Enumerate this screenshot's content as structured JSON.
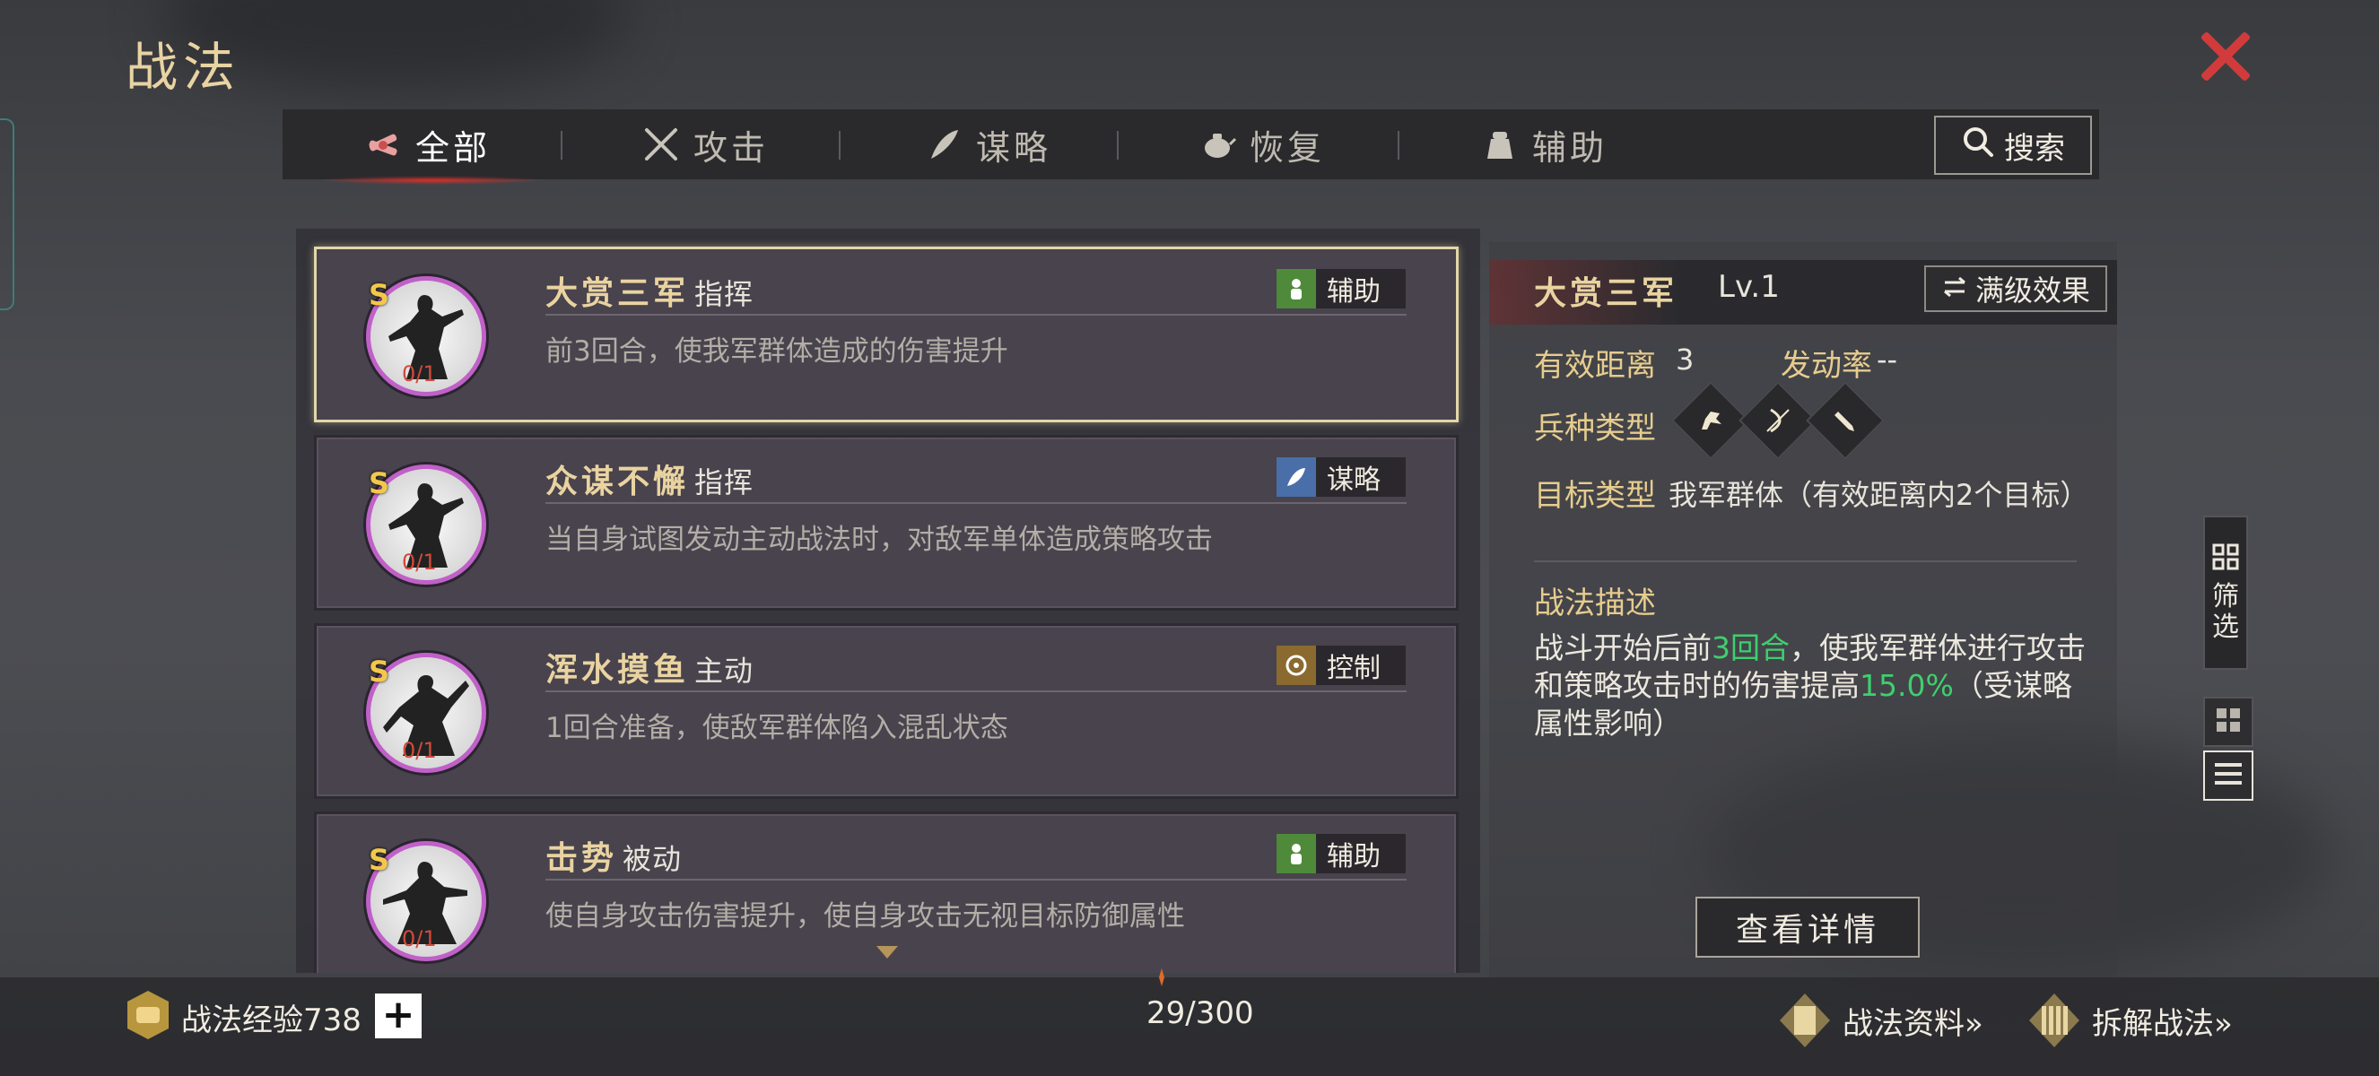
{
  "header": {
    "title": "战法"
  },
  "tabs": [
    {
      "label": "全部",
      "icon": "scroll-bundle-icon",
      "active": true
    },
    {
      "label": "攻击",
      "icon": "crossed-swords-icon"
    },
    {
      "label": "谋略",
      "icon": "feather-icon"
    },
    {
      "label": "恢复",
      "icon": "teapot-icon"
    },
    {
      "label": "辅助",
      "icon": "pouch-icon"
    }
  ],
  "search": {
    "label": "搜索"
  },
  "skills": [
    {
      "grade": "S",
      "name": "大赏三军",
      "kind": "指挥",
      "tag": "辅助",
      "tag_color": "#4f8a3a",
      "count": "0/1",
      "desc": "前3回合，使我军群体造成的伤害提升"
    },
    {
      "grade": "S",
      "name": "众谋不懈",
      "kind": "指挥",
      "tag": "谋略",
      "tag_color": "#4a6fa8",
      "count": "0/1",
      "desc": "当自身试图发动主动战法时，对敌军单体造成策略攻击"
    },
    {
      "grade": "S",
      "name": "浑水摸鱼",
      "kind": "主动",
      "tag": "控制",
      "tag_color": "#8a6a2f",
      "count": "0/1",
      "desc": "1回合准备，使敌军群体陷入混乱状态"
    },
    {
      "grade": "S",
      "name": "击势",
      "kind": "被动",
      "tag": "辅助",
      "tag_color": "#4f8a3a",
      "count": "0/1",
      "desc": "使自身攻击伤害提升，使自身攻击无视目标防御属性"
    }
  ],
  "detail": {
    "name": "大赏三军",
    "level": "Lv.1",
    "max_label": "满级效果",
    "range_label": "有效距离",
    "range_value": "3",
    "rate_label": "发动率",
    "rate_value": "--",
    "unit_label": "兵种类型",
    "unit_icons": [
      "cavalry-icon",
      "archer-icon",
      "spear-icon"
    ],
    "target_label": "目标类型",
    "target_value": "我军群体（有效距离内2个目标）",
    "desc_label": "战法描述",
    "desc_pre": "战斗开始后前",
    "desc_hl1": "3回合",
    "desc_mid": "，使我军群体进行攻击和策略攻击时的伤害提高",
    "desc_hl2": "15.0%",
    "desc_post": "（受谋略属性影响）",
    "view_button": "查看详情"
  },
  "side": {
    "filter_top": "筛",
    "filter_bottom": "选"
  },
  "footer": {
    "exp_label": "战法经验738",
    "plus": "+",
    "pager": "29/300",
    "info_link": "战法资料»",
    "dismantle_link": "拆解战法»"
  },
  "colors": {
    "accent_gold": "#e9d3a0",
    "highlight_green": "#3fcf6e",
    "close_red": "#d13b3b"
  }
}
